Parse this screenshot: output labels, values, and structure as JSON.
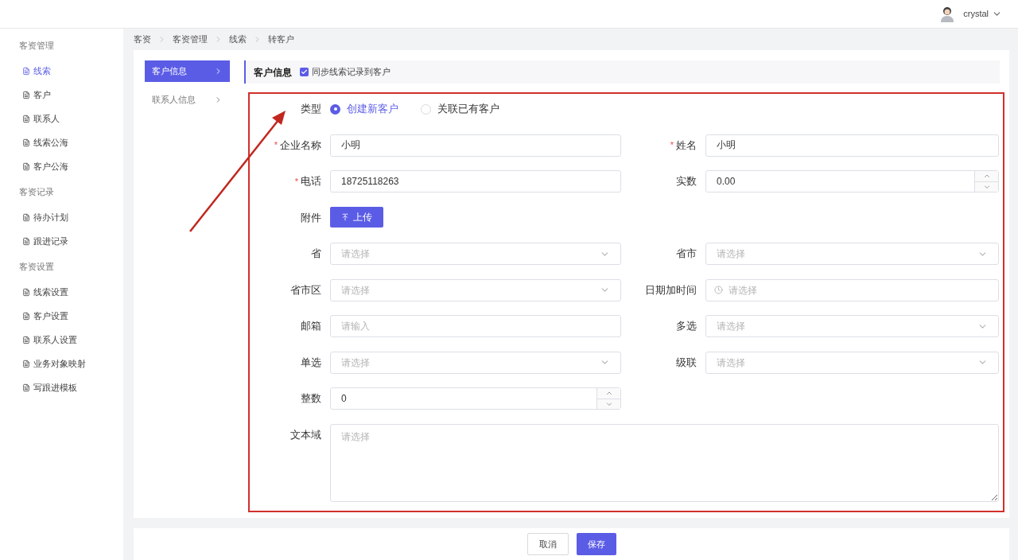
{
  "header": {
    "user": "crystal"
  },
  "sidebar": {
    "groups": [
      {
        "title": "客资管理",
        "items": [
          {
            "label": "线索",
            "selected": true
          },
          {
            "label": "客户",
            "selected": false
          },
          {
            "label": "联系人",
            "selected": false
          },
          {
            "label": "线索公海",
            "selected": false
          },
          {
            "label": "客户公海",
            "selected": false
          }
        ]
      },
      {
        "title": "客资记录",
        "items": [
          {
            "label": "待办计划",
            "selected": false
          },
          {
            "label": "跟进记录",
            "selected": false
          }
        ]
      },
      {
        "title": "客资设置",
        "items": [
          {
            "label": "线索设置",
            "selected": false
          },
          {
            "label": "客户设置",
            "selected": false
          },
          {
            "label": "联系人设置",
            "selected": false
          },
          {
            "label": "业务对象映射",
            "selected": false
          },
          {
            "label": "写跟进模板",
            "selected": false
          }
        ]
      }
    ]
  },
  "breadcrumb": [
    "客资",
    "客资管理",
    "线索",
    "转客户"
  ],
  "section_menu": [
    {
      "label": "客户信息",
      "selected": true
    },
    {
      "label": "联系人信息",
      "selected": false
    }
  ],
  "section_header": {
    "title": "客户信息",
    "sync": {
      "label": "同步线索记录到客户",
      "checked": true
    }
  },
  "form": {
    "rows": [
      {
        "cells": [
          {
            "kind": "radio",
            "label": "类型",
            "options": [
              {
                "label": "创建新客户",
                "selected": true
              },
              {
                "label": "关联已有客户",
                "selected": false
              }
            ]
          }
        ]
      },
      {
        "cells": [
          {
            "kind": "text",
            "label": "企业名称",
            "required_mark": "*",
            "value": "小明"
          },
          {
            "kind": "text",
            "label": "姓名",
            "required_mark": "*",
            "value": "小明"
          }
        ]
      },
      {
        "cells": [
          {
            "kind": "text",
            "label": "电话",
            "required_mark": "*",
            "value": "18725118263"
          },
          {
            "kind": "number",
            "label": "实数",
            "value": "0.00"
          }
        ]
      },
      {
        "cells": [
          {
            "kind": "upload",
            "label": "附件",
            "button": "上传"
          }
        ]
      },
      {
        "cells": [
          {
            "kind": "select",
            "label": "省",
            "placeholder": "请选择"
          },
          {
            "kind": "select",
            "label": "省市",
            "placeholder": "请选择"
          }
        ]
      },
      {
        "cells": [
          {
            "kind": "select",
            "label": "省市区",
            "placeholder": "请选择"
          },
          {
            "kind": "date",
            "label": "日期加时间",
            "placeholder": "请选择"
          }
        ]
      },
      {
        "cells": [
          {
            "kind": "text",
            "label": "邮箱",
            "placeholder": "请输入"
          },
          {
            "kind": "select",
            "label": "多选",
            "placeholder": "请选择"
          }
        ]
      },
      {
        "cells": [
          {
            "kind": "select",
            "label": "单选",
            "placeholder": "请选择"
          },
          {
            "kind": "select",
            "label": "级联",
            "placeholder": "请选择"
          }
        ]
      },
      {
        "cells": [
          {
            "kind": "number",
            "label": "整数",
            "value": "0"
          }
        ]
      },
      {
        "cells": [
          {
            "kind": "textarea",
            "label": "文本域",
            "placeholder": "请选择"
          }
        ]
      }
    ]
  },
  "footer": {
    "buttons": [
      {
        "label": "取消",
        "kind": "default"
      },
      {
        "label": "保存",
        "kind": "primary"
      }
    ]
  }
}
